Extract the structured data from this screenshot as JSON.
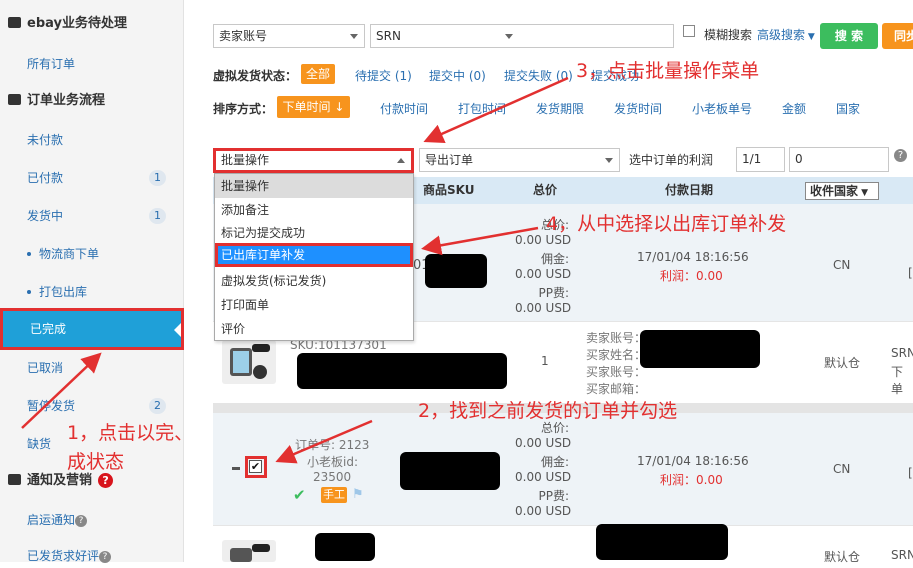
{
  "sidebar": {
    "sections": [
      {
        "title": "ebay业务待处理"
      },
      {
        "title": "订单业务流程"
      },
      {
        "title": "通知及营销"
      }
    ],
    "items": {
      "all_orders": "所有订单",
      "unpaid": "未付款",
      "paid": {
        "label": "已付款",
        "badge": "1"
      },
      "shipping": {
        "label": "发货中",
        "badge": "1"
      },
      "logistics": "物流商下单",
      "packing": "打包出库",
      "completed": "已完成",
      "cancelled": "已取消",
      "paused": {
        "label": "暂停发货",
        "badge": "2"
      },
      "shortage": "缺货",
      "shipping_notice": "启运通知",
      "review_request": "已发货求好评"
    }
  },
  "search": {
    "seller_account": "卖家账号",
    "field": "SRN",
    "fuzzy": "模糊搜索",
    "advanced": "高级搜索",
    "search_btn": "搜 索",
    "sync_btn": "同步"
  },
  "filters": {
    "virtual_label": "虚拟发货状态：",
    "virtual_options": [
      "全部",
      "待提交 (1)",
      "提交中 (0)",
      "提交失败 (0)",
      "提交成功"
    ],
    "sort_label": "排序方式：",
    "sort_active": "下单时间",
    "sort_options": [
      "付款时间",
      "打包时间",
      "发货期限",
      "发货时间",
      "小老板单号",
      "金额",
      "国家"
    ]
  },
  "toolbar": {
    "batch": "批量操作",
    "export": "导出订单",
    "profit_label": "选中订单的利润",
    "profit_rate": "1/1",
    "profit_value": "0"
  },
  "dropdown": {
    "items": [
      "批量操作",
      "添加备注",
      "标记为提交成功",
      "已出库订单补发",
      "虚拟发货(标记发货)",
      "打印面单",
      "评价"
    ]
  },
  "table": {
    "headers": {
      "sku": "商品SKU",
      "total": "总价",
      "paydate": "付款日期",
      "country": "收件国家"
    },
    "order1": {
      "total_label": "总价:",
      "total": "0.00 USD",
      "commission_label": "佣金:",
      "commission": "0.00 USD",
      "pp_label": "PP费:",
      "pp": "0.00 USD",
      "date": "17/01/04 18:16:56",
      "profit": "利润：0.00",
      "country": "CN",
      "partial_id": "011"
    },
    "item1": {
      "sku": "SKU:101137301",
      "qty": "1",
      "seller": "卖家账号：",
      "buyer_name": "买家姓名：",
      "buyer_account": "买家账号：",
      "buyer_email": "买家邮箱：",
      "warehouse": "默认仓",
      "srn": "SRN",
      "ship": "下单"
    },
    "order2": {
      "order_no": "订单号: 2123",
      "xlb_id": "小老板id:",
      "xlb_val": "23500",
      "tag": "手工",
      "total_label": "总价:",
      "total": "0.00 USD",
      "commission_label": "佣金:",
      "commission": "0.00 USD",
      "pp_label": "PP费:",
      "pp": "0.00 USD",
      "date": "17/01/04 18:16:56",
      "profit": "利润：0.00",
      "country": "CN"
    },
    "item2": {
      "warehouse": "默认仓",
      "srn": "SRN"
    }
  },
  "annotations": {
    "step1a": "1，点击以完、",
    "step1b": "成状态",
    "step2": "2，找到之前发货的订单并勾选",
    "step3": "3，点击批量操作菜单",
    "step4": "4，从中选择以出库订单补发"
  }
}
